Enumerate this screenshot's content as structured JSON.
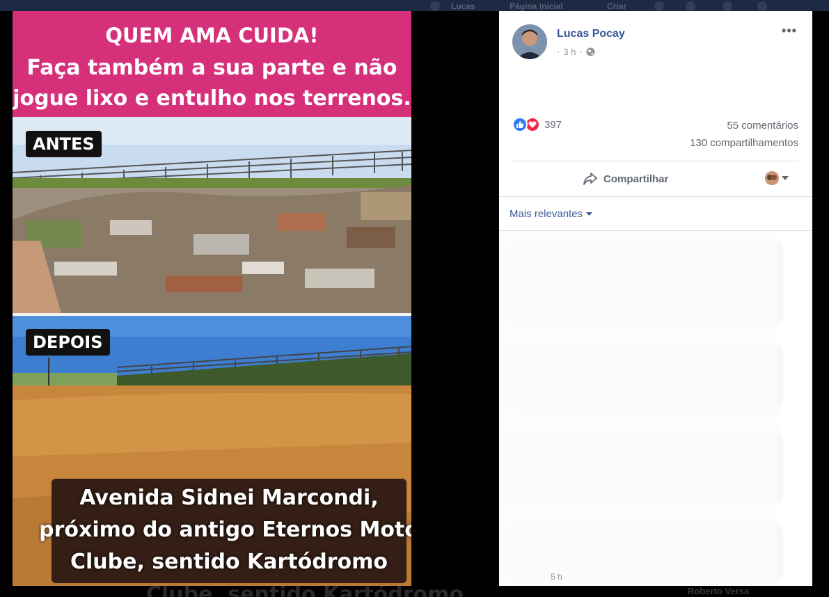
{
  "topbar": {
    "links": [
      "Lucas",
      "Página inicial",
      "Criar"
    ]
  },
  "photo": {
    "banner_lines": [
      "QUEM AMA CUIDA!",
      "Faça também a sua parte e não",
      "jogue lixo e entulho nos terrenos."
    ],
    "tag_before": "ANTES",
    "tag_after": "DEPOIS",
    "caption_lines": [
      "Avenida Sidnei Marcondi,",
      "próximo do antigo Eternos Moto",
      "Clube, sentido Kartódromo"
    ]
  },
  "post": {
    "author": "Lucas Pocay",
    "time": "3 h",
    "privacy_icon": "globe-icon",
    "more_label": "•••",
    "reactions": {
      "types": [
        "like",
        "love"
      ],
      "count": "397"
    },
    "comments_count": "55 comentários",
    "shares_count": "130 compartilhamentos",
    "share_label": "Compartilhar",
    "sort_label": "Mais relevantes",
    "stray_time": "5 h"
  },
  "background": {
    "ghost_caption": "Clube, sentido Kartódromo",
    "ghost_name": "Roberto Versa"
  },
  "colors": {
    "banner": "#d6307a",
    "link": "#365899",
    "like": "#2e7bf5",
    "love": "#f0284a"
  }
}
